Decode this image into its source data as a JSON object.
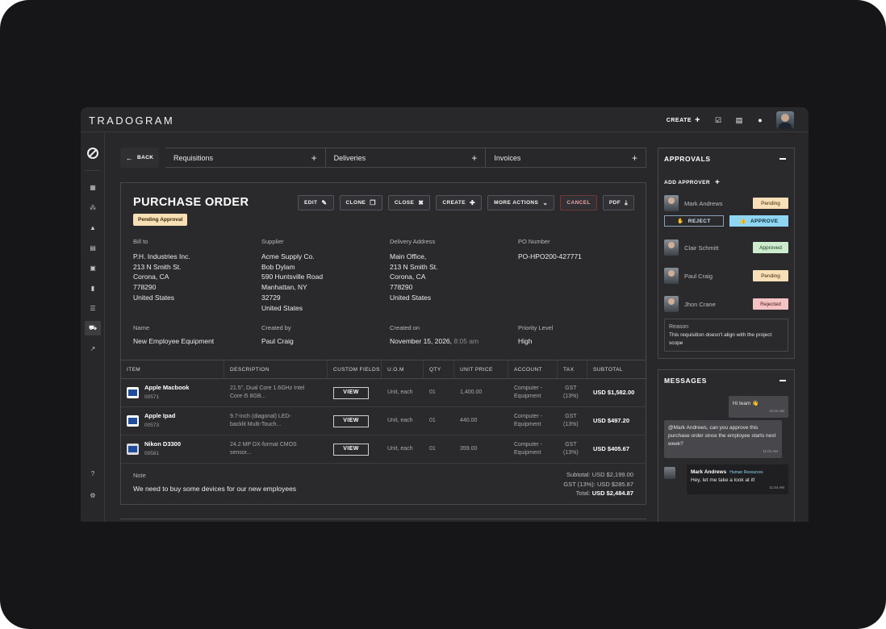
{
  "app": {
    "logo": "TRADOGRAM"
  },
  "topbar": {
    "create_label": "CREATE"
  },
  "tabs": {
    "back_label": "BACK",
    "items": [
      {
        "label": "Requisitions"
      },
      {
        "label": "Deliveries"
      },
      {
        "label": "Invoices"
      }
    ]
  },
  "po": {
    "title": "PURCHASE ORDER",
    "status": "Pending Approval",
    "actions": {
      "edit": "EDIT",
      "clone": "CLONE",
      "close": "CLOSE",
      "create": "CREATE",
      "more": "MORE ACTIONS",
      "cancel": "CANCEL",
      "pdf": "PDF"
    },
    "bill_to": {
      "label": "Bill to",
      "value": "P.H. Industries Inc.\n213 N Smith St.\nCorona, CA\n778290\nUnited States"
    },
    "supplier": {
      "label": "Supplier",
      "value": "Acme Supply Co.\nBob Dylam\n590 Huntsville Road\nManhattan, NY\n32729\nUnited States"
    },
    "delivery": {
      "label": "Delivery Address",
      "value": "Main Office,\n213 N Smith St.\nCorona, CA\n778290\nUnited States"
    },
    "po_number": {
      "label": "PO Number",
      "value": "PO-HPO200-427771"
    },
    "name": {
      "label": "Name",
      "value": "New Employee Equipment"
    },
    "created_by": {
      "label": "Created by",
      "value": "Paul Craig"
    },
    "created_on": {
      "label": "Created on",
      "value": "November 15, 2026,",
      "time": "8:05 am"
    },
    "priority": {
      "label": "Priority Level",
      "value": "High"
    },
    "table": {
      "headers": [
        "ITEM",
        "DESCRIPTION",
        "CUSTOM FIELDS",
        "U.O.M",
        "QTY",
        "UNIT PRICE",
        "ACCOUNT",
        "TAX",
        "SUBTOTAL"
      ],
      "rows": [
        {
          "name": "Apple Macbook",
          "code": "00571",
          "desc": "21.5\", Dual Core 1.6GHz Intel\nCore i5 8GB...",
          "view": "VIEW",
          "uom": "Unit, each",
          "qty": "01",
          "price": "1,400.00",
          "account": "Computer -\nEquipment",
          "tax": "GST\n(13%)",
          "subtotal": "USD $1,582.00"
        },
        {
          "name": "Apple Ipad",
          "code": "00573",
          "desc": "9.7-inch (diagonal) LED-\nbacklit Multi-Touch...",
          "view": "VIEW",
          "uom": "Unit, each",
          "qty": "01",
          "price": "440.00",
          "account": "Computer -\nEquipment",
          "tax": "GST\n(13%)",
          "subtotal": "USD $497.20"
        },
        {
          "name": "Nikon D3300",
          "code": "00581",
          "desc": "24.2 MP DX-format CMOS\nsensor...",
          "view": "VIEW",
          "uom": "Unit, each",
          "qty": "01",
          "price": "359.00",
          "account": "Computer -\nEquipment",
          "tax": "GST\n(13%)",
          "subtotal": "USD $405.67"
        }
      ]
    },
    "note": {
      "label": "Note",
      "value": "We need to buy some devices for our new employees"
    },
    "totals": {
      "subtotal_label": "Subtotal:",
      "subtotal": "USD $2,199.00",
      "tax_label": "GST (13%):",
      "tax": "USD $285.87",
      "total_label": "Total:",
      "total": "USD $2,484.87"
    }
  },
  "approvals": {
    "title": "APPROVALS",
    "add_label": "ADD APPROVER",
    "reject_label": "REJECT",
    "approve_label": "APPROVE",
    "approvers": [
      {
        "name": "Mark Andrews",
        "status": "Pending"
      },
      {
        "name": "Clair Schmitt",
        "status": "Approved"
      },
      {
        "name": "Paul Craig",
        "status": "Pending"
      },
      {
        "name": "Jhon Crane",
        "status": "Rejected"
      }
    ],
    "reason": {
      "label": "Reason",
      "text": "This requisition doesn't align with the project scope"
    }
  },
  "messages": {
    "title": "MESSAGES",
    "items": [
      {
        "text": "Hi team 👋",
        "time": "11:01 AM"
      },
      {
        "text": "@Mark Andrews, can you approve this purchase order since the employee starts next week?",
        "time": "11:01 AM"
      },
      {
        "sender": "Mark Andrews",
        "role": "Human Resources",
        "text": "Hey, let me take a look at it!",
        "time": "11:54 AM"
      }
    ]
  }
}
